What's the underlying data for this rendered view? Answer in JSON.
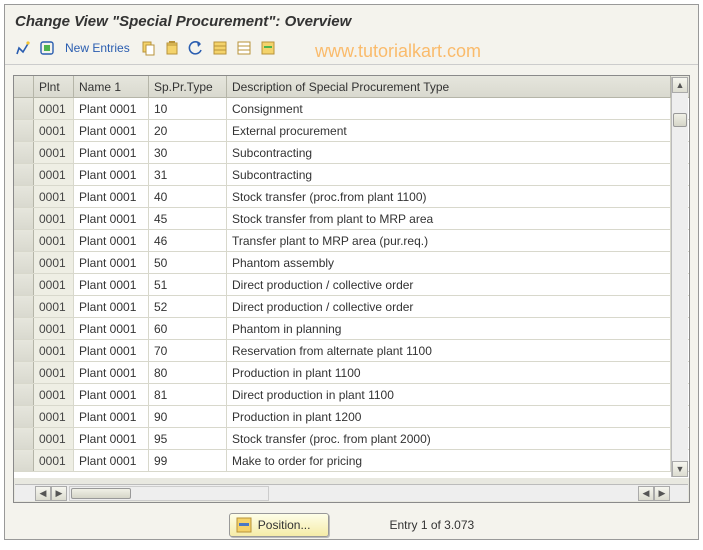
{
  "title": "Change View \"Special Procurement\": Overview",
  "toolbar": {
    "new_entries_label": "New Entries"
  },
  "watermark": "www.tutorialkart.com",
  "grid": {
    "headers": {
      "plnt": "Plnt",
      "name1": "Name 1",
      "sptype": "Sp.Pr.Type",
      "desc": "Description of Special Procurement Type"
    },
    "rows": [
      {
        "plnt": "0001",
        "name": "Plant 0001",
        "type": "10",
        "desc": "Consignment"
      },
      {
        "plnt": "0001",
        "name": "Plant 0001",
        "type": "20",
        "desc": "External procurement"
      },
      {
        "plnt": "0001",
        "name": "Plant 0001",
        "type": "30",
        "desc": "Subcontracting"
      },
      {
        "plnt": "0001",
        "name": "Plant 0001",
        "type": "31",
        "desc": "Subcontracting"
      },
      {
        "plnt": "0001",
        "name": "Plant 0001",
        "type": "40",
        "desc": "Stock transfer (proc.from plant 1100)"
      },
      {
        "plnt": "0001",
        "name": "Plant 0001",
        "type": "45",
        "desc": "Stock transfer from plant to MRP area"
      },
      {
        "plnt": "0001",
        "name": "Plant 0001",
        "type": "46",
        "desc": "Transfer plant to MRP area (pur.req.)"
      },
      {
        "plnt": "0001",
        "name": "Plant 0001",
        "type": "50",
        "desc": "Phantom assembly"
      },
      {
        "plnt": "0001",
        "name": "Plant 0001",
        "type": "51",
        "desc": "Direct production / collective order"
      },
      {
        "plnt": "0001",
        "name": "Plant 0001",
        "type": "52",
        "desc": "Direct production / collective order"
      },
      {
        "plnt": "0001",
        "name": "Plant 0001",
        "type": "60",
        "desc": "Phantom in planning"
      },
      {
        "plnt": "0001",
        "name": "Plant 0001",
        "type": "70",
        "desc": "Reservation from alternate plant 1100"
      },
      {
        "plnt": "0001",
        "name": "Plant 0001",
        "type": "80",
        "desc": "Production        in plant 1100"
      },
      {
        "plnt": "0001",
        "name": "Plant 0001",
        "type": "81",
        "desc": "Direct production in plant 1100"
      },
      {
        "plnt": "0001",
        "name": "Plant 0001",
        "type": "90",
        "desc": "Production        in plant 1200"
      },
      {
        "plnt": "0001",
        "name": "Plant 0001",
        "type": "95",
        "desc": "Stock transfer (proc. from plant 2000)"
      },
      {
        "plnt": "0001",
        "name": "Plant 0001",
        "type": "99",
        "desc": "Make to order for pricing"
      }
    ]
  },
  "footer": {
    "position_label": "Position...",
    "entry_text": "Entry 1 of 3.073"
  }
}
